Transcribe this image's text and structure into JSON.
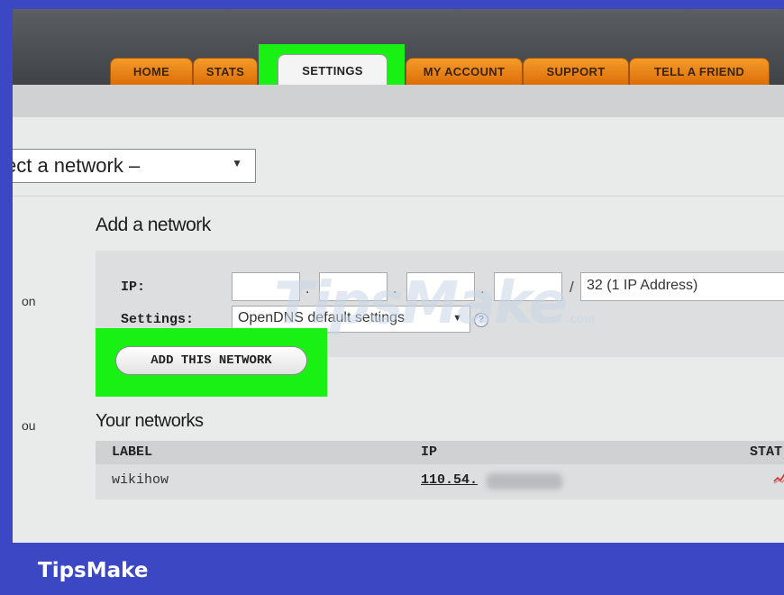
{
  "tabs": [
    {
      "label": "HOME"
    },
    {
      "label": "STATS"
    },
    {
      "label": "SETTINGS"
    },
    {
      "label": "MY ACCOUNT"
    },
    {
      "label": "SUPPORT"
    },
    {
      "label": "TELL A FRIEND"
    }
  ],
  "network_select": {
    "value": "ect a network –"
  },
  "add_network": {
    "heading": "Add a network",
    "ip_label": "IP:",
    "settings_label": "Settings:",
    "ip_separator": ".",
    "mask_separator": "/",
    "mask_value": "32 (1 IP Address)",
    "settings_value": "OpenDNS default settings",
    "help_icon": "?",
    "button_label": "ADD THIS NETWORK"
  },
  "your_networks": {
    "heading": "Your networks",
    "columns": [
      "LABEL",
      "IP",
      "STAT"
    ],
    "rows": [
      {
        "label": "wikihow",
        "ip": "110.54."
      }
    ]
  },
  "side_text": [
    "on",
    "ou"
  ],
  "watermark": {
    "text": "TipsMake",
    "suffix": ".com"
  },
  "footer": {
    "brand": "TipsMake"
  },
  "colors": {
    "tab_orange": "#ee8a1c",
    "highlight_green": "#19f013",
    "footer_blue": "#3c47c4"
  },
  "icons": {
    "select_arrow": "▼",
    "status": "status-graph-icon"
  }
}
